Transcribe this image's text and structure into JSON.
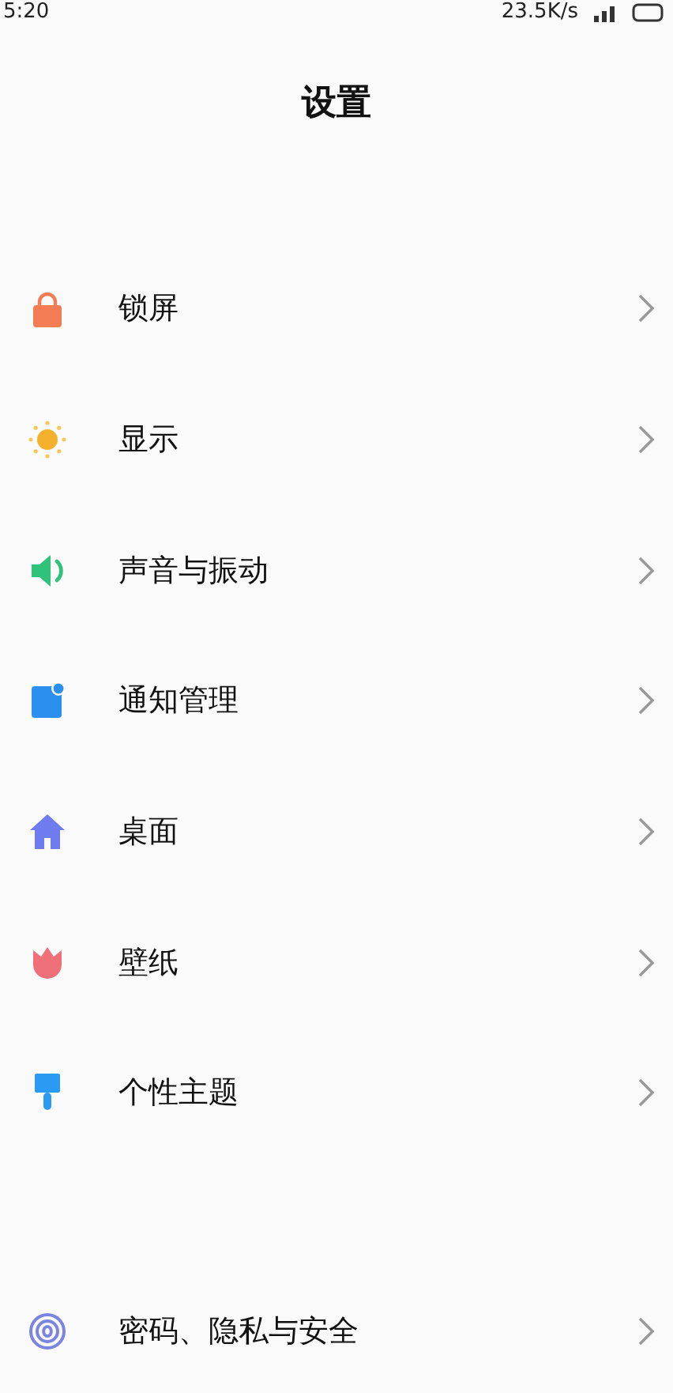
{
  "status_bar": {
    "time": "5:20",
    "speed": "23.5K/s"
  },
  "title": "设置",
  "groups": [
    {
      "items": [
        {
          "label": "锁屏"
        },
        {
          "label": "显示"
        },
        {
          "label": "声音与振动"
        },
        {
          "label": "通知管理"
        },
        {
          "label": "桌面"
        },
        {
          "label": "壁纸"
        },
        {
          "label": "个性主题"
        }
      ]
    },
    {
      "items": [
        {
          "label": "密码、隐私与安全"
        }
      ]
    }
  ]
}
